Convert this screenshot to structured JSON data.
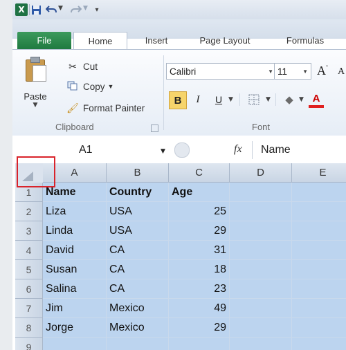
{
  "quick_access": {
    "app_icon_glyph": "X",
    "icons": [
      "excel-app-icon",
      "save-icon",
      "undo-icon",
      "redo-icon",
      "customize-toolbar-icon"
    ]
  },
  "tabs": [
    {
      "label": "File"
    },
    {
      "label": "Home"
    },
    {
      "label": "Insert"
    },
    {
      "label": "Page Layout"
    },
    {
      "label": "Formulas"
    }
  ],
  "clipboard_group": {
    "paste": "Paste",
    "cut": "Cut",
    "copy": "Copy",
    "format_painter": "Format Painter",
    "label": "Clipboard"
  },
  "font_group": {
    "font_name": "Calibri",
    "font_size": "11",
    "bold": "B",
    "italic": "I",
    "underline": "U",
    "label": "Font"
  },
  "formula_bar": {
    "name_box": "A1",
    "fx": "fx",
    "content": "Name"
  },
  "columns": [
    "A",
    "B",
    "C",
    "D",
    "E"
  ],
  "rows": [
    {
      "num": "1",
      "cells": [
        "Name",
        "Country",
        "Age",
        "",
        ""
      ]
    },
    {
      "num": "2",
      "cells": [
        "Liza",
        "USA",
        "25",
        "",
        ""
      ]
    },
    {
      "num": "3",
      "cells": [
        "Linda",
        "USA",
        "29",
        "",
        ""
      ]
    },
    {
      "num": "4",
      "cells": [
        "David",
        "CA",
        "31",
        "",
        ""
      ]
    },
    {
      "num": "5",
      "cells": [
        "Susan",
        "CA",
        "18",
        "",
        ""
      ]
    },
    {
      "num": "6",
      "cells": [
        "Salina",
        "CA",
        "23",
        "",
        ""
      ]
    },
    {
      "num": "7",
      "cells": [
        "Jim",
        "Mexico",
        "49",
        "",
        ""
      ]
    },
    {
      "num": "8",
      "cells": [
        "Jorge",
        "Mexico",
        "29",
        "",
        ""
      ]
    },
    {
      "num": "9",
      "cells": [
        "",
        "",
        "",
        "",
        ""
      ]
    }
  ],
  "colors": {
    "selection": "#bcd4ef",
    "file_tab": "#217346",
    "highlight_box": "#d9232b"
  }
}
